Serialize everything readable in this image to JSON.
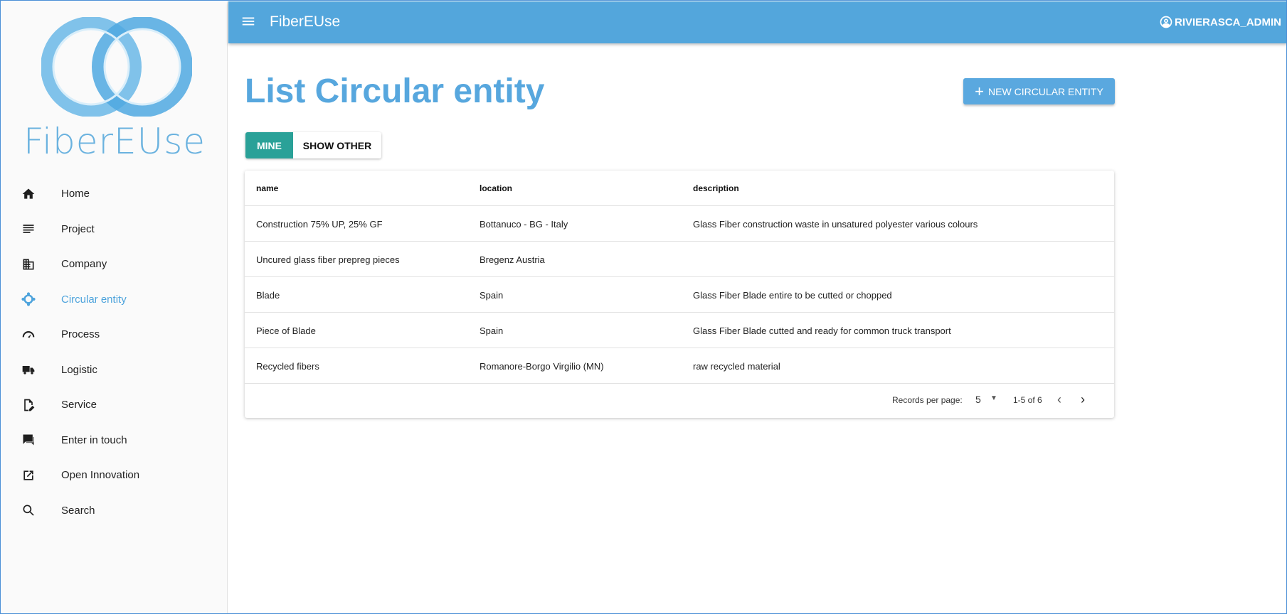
{
  "app": {
    "title": "FiberEUse",
    "logo_text": "FiberEUse"
  },
  "user": {
    "name": "RIVIERASCA_ADMIN",
    "icon": "account-circle-icon"
  },
  "sidebar": {
    "items": [
      {
        "label": "Home",
        "icon": "home-icon"
      },
      {
        "label": "Project",
        "icon": "list-icon"
      },
      {
        "label": "Company",
        "icon": "building-icon"
      },
      {
        "label": "Circular entity",
        "icon": "circular-entity-icon",
        "active": true
      },
      {
        "label": "Process",
        "icon": "gauge-icon"
      },
      {
        "label": "Logistic",
        "icon": "truck-icon"
      },
      {
        "label": "Service",
        "icon": "document-edit-icon"
      },
      {
        "label": "Enter in touch",
        "icon": "chat-icon"
      },
      {
        "label": "Open Innovation",
        "icon": "open-external-icon"
      },
      {
        "label": "Search",
        "icon": "search-icon"
      }
    ]
  },
  "main": {
    "title": "List Circular entity",
    "new_button": "NEW CIRCULAR ENTITY",
    "toggle": {
      "mine": "MINE",
      "other": "SHOW OTHER",
      "selected": "MINE"
    }
  },
  "table": {
    "columns": {
      "name": "name",
      "location": "location",
      "description": "description"
    },
    "rows": [
      {
        "name": "Construction 75% UP, 25% GF",
        "location": "Bottanuco - BG - Italy",
        "description": "Glass Fiber construction waste in unsatured polyester various colours"
      },
      {
        "name": "Uncured glass fiber prepreg pieces",
        "location": "Bregenz Austria",
        "description": ""
      },
      {
        "name": "Blade",
        "location": "Spain",
        "description": "Glass Fiber Blade entire to be cutted or chopped"
      },
      {
        "name": "Piece of Blade",
        "location": "Spain",
        "description": "Glass Fiber Blade cutted and ready for common truck transport"
      },
      {
        "name": "Recycled fibers",
        "location": "Romanore-Borgo Virgilio (MN)",
        "description": "raw recycled material"
      }
    ],
    "pagination": {
      "label": "Records per page:",
      "per_page": "5",
      "range": "1-5 of 6"
    }
  },
  "colors": {
    "topbar": "#53a6dc",
    "accent": "#57a7de",
    "toggle_active": "#2aa198"
  }
}
